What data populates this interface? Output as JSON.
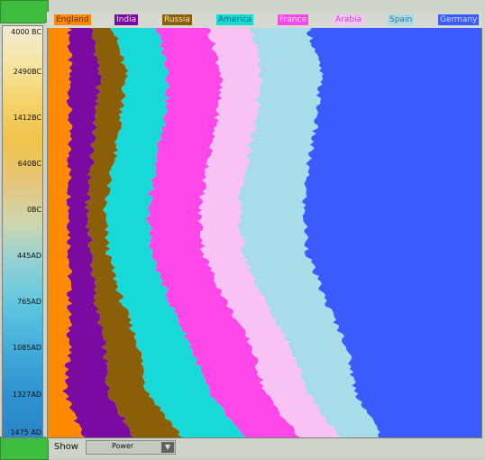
{
  "legend": [
    {
      "label": "England",
      "color": "#ff8a00",
      "text": "#5a2a00"
    },
    {
      "label": "India",
      "color": "#7b0aa3",
      "text": "#f2dcff"
    },
    {
      "label": "Russia",
      "color": "#8b5f08",
      "text": "#f4e2b4"
    },
    {
      "label": "America",
      "color": "#17dad8",
      "text": "#0d6b6b"
    },
    {
      "label": "France",
      "color": "#ff47ea",
      "text": "#ffe6fb"
    },
    {
      "label": "Arabia",
      "color": "#f8c2f4",
      "text": "#b24dbc"
    },
    {
      "label": "Spain",
      "color": "#a9dce9",
      "text": "#3b6f7e"
    },
    {
      "label": "Germany",
      "color": "#3a5cff",
      "text": "#cfe0ff"
    }
  ],
  "timeline": {
    "ticks": [
      "4000 BC",
      "2490BC",
      "1412BC",
      "640BC",
      "0BC",
      "445AD",
      "765AD",
      "1085AD",
      "1327AD",
      "1475 AD"
    ]
  },
  "controls": {
    "show_label": "Show",
    "show_value": "Power"
  },
  "chart_data": {
    "type": "area",
    "title": "",
    "x_axis": "time",
    "x": [
      "4000 BC",
      "2490BC",
      "1412BC",
      "640BC",
      "0BC",
      "445AD",
      "765AD",
      "1085AD",
      "1327AD",
      "1475 AD"
    ],
    "series": [
      {
        "name": "England",
        "values": [
          5,
          5,
          5,
          5,
          5,
          5,
          5,
          5,
          4,
          8
        ]
      },
      {
        "name": "India",
        "values": [
          5,
          7,
          6,
          5,
          4,
          5,
          6,
          8,
          10,
          12
        ]
      },
      {
        "name": "Russia",
        "values": [
          5,
          6,
          6,
          5,
          4,
          4,
          6,
          8,
          9,
          11
        ]
      },
      {
        "name": "America",
        "values": [
          10,
          10,
          10,
          10,
          10,
          10,
          11,
          12,
          14,
          14
        ]
      },
      {
        "name": "France",
        "values": [
          12,
          12,
          12,
          12,
          12,
          12,
          13,
          14,
          13,
          13
        ]
      },
      {
        "name": "Arabia",
        "values": [
          10,
          9,
          9,
          9,
          9,
          9,
          9,
          9,
          10,
          9
        ]
      },
      {
        "name": "Spain",
        "values": [
          13,
          14,
          14,
          14,
          15,
          15,
          14,
          13,
          11,
          10
        ]
      },
      {
        "name": "Germany",
        "values": [
          40,
          37,
          38,
          40,
          41,
          40,
          36,
          31,
          29,
          23
        ]
      }
    ]
  }
}
